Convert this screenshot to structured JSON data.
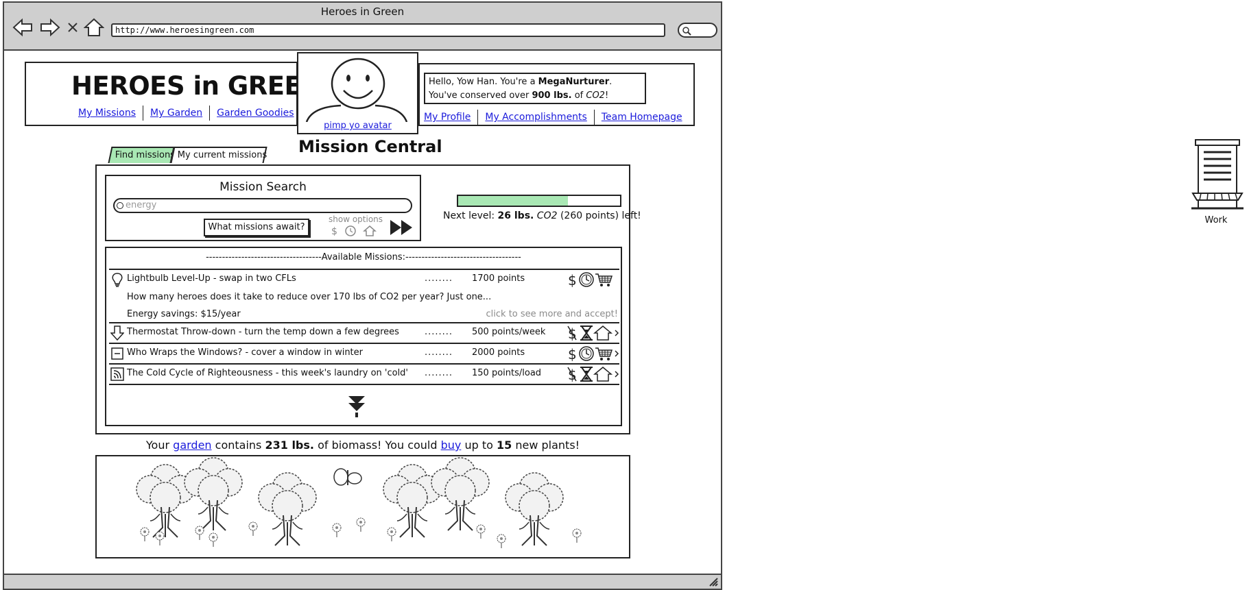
{
  "browser": {
    "window_title": "Heroes in Green",
    "url": "http://www.heroesingreen.com"
  },
  "header": {
    "site_title": "HEROES in GREEN!",
    "nav": [
      "My Missions",
      "My Garden",
      "Garden Goodies"
    ],
    "avatar_link": "pimp yo avatar",
    "greeting": {
      "hello": "Hello, Yow Han. You're a ",
      "rank": "MegaNurturer",
      "rank_end": ".",
      "conserved_prefix": "You've conserved over ",
      "conserved_amount": "900 lbs.",
      "conserved_mid": " of ",
      "conserved_unit": "CO2",
      "conserved_end": "!"
    },
    "profile_nav": [
      "My Profile",
      "My Accomplishments",
      "Team Homepage"
    ]
  },
  "mission_central": {
    "title": "Mission Central",
    "tabs": [
      "Find missions",
      "My current missions"
    ],
    "active_tab": "Find missions",
    "search": {
      "title": "Mission Search",
      "placeholder": "energy",
      "submit_label": "What missions await?",
      "show_options": "show options"
    },
    "progress": {
      "fraction": 0.68,
      "prefix": "Next level: ",
      "amount": "26 lbs.",
      "unit": " CO2",
      "suffix": " (260 points) left!"
    },
    "missions": {
      "header": "------------------------------------Available Missions:------------------------------------",
      "items": [
        {
          "icon": "lightbulb-icon",
          "title": "Lightbulb Level-Up - swap in two CFLs",
          "dots": "........",
          "points": "1700 points",
          "description": "How many heroes does it take to reduce over 170 lbs of CO2 per year? Just one...",
          "savings": "Energy savings: $15/year",
          "accept": "click to see more and accept!",
          "tags": [
            "money-icon",
            "clock-icon",
            "cart-icon"
          ]
        },
        {
          "icon": "down-arrow-icon",
          "title": "Thermostat Throw-down - turn the temp down a few degrees",
          "dots": "........",
          "points": "500 points/week",
          "tags": [
            "no-money-icon",
            "hourglass-icon",
            "home-icon"
          ]
        },
        {
          "icon": "window-icon",
          "title": "Who Wraps the Windows? - cover a window in winter",
          "dots": "........",
          "points": "2000 points",
          "tags": [
            "money-icon",
            "clock-icon",
            "cart-icon"
          ]
        },
        {
          "icon": "laundry-icon",
          "title": "The Cold Cycle of Righteousness - this week's laundry on 'cold'",
          "dots": "........",
          "points": "150 points/load",
          "tags": [
            "no-money-icon",
            "hourglass-icon",
            "home-icon"
          ]
        }
      ]
    }
  },
  "garden": {
    "p1": "Your ",
    "garden_link": "garden",
    "p2": " contains ",
    "biomass": "231 lbs.",
    "p3": " of biomass! You could ",
    "buy_link": "buy",
    "p4": " up to ",
    "plants": "15",
    "p5": " new plants!"
  },
  "work": {
    "label": "Work"
  },
  "colors": {
    "accent_green": "#a9e8b4",
    "link_blue": "#1a1adb",
    "chrome_gray": "#cfcfcf"
  }
}
